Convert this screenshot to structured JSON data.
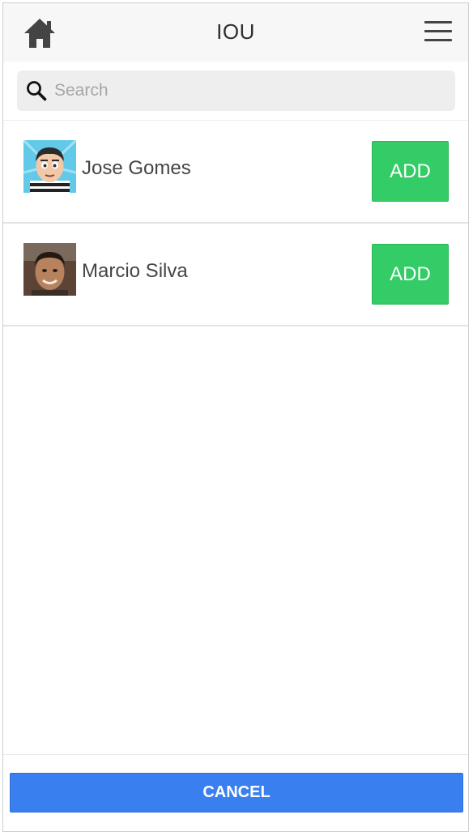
{
  "header": {
    "title": "IOU",
    "home_icon": "home-icon",
    "menu_icon": "hamburger-menu-icon"
  },
  "search": {
    "placeholder": "Search",
    "value": "",
    "icon": "search-icon"
  },
  "contacts": [
    {
      "name": "Jose Gomes",
      "add_label": "ADD",
      "avatar": "cartoon-avatar"
    },
    {
      "name": "Marcio Silva",
      "add_label": "ADD",
      "avatar": "photo-avatar"
    }
  ],
  "footer": {
    "cancel_label": "CANCEL"
  },
  "colors": {
    "add_button": "#33cc66",
    "cancel_button": "#3a7ff0",
    "header_bg": "#f7f7f7",
    "search_bg": "#eeeeee"
  }
}
